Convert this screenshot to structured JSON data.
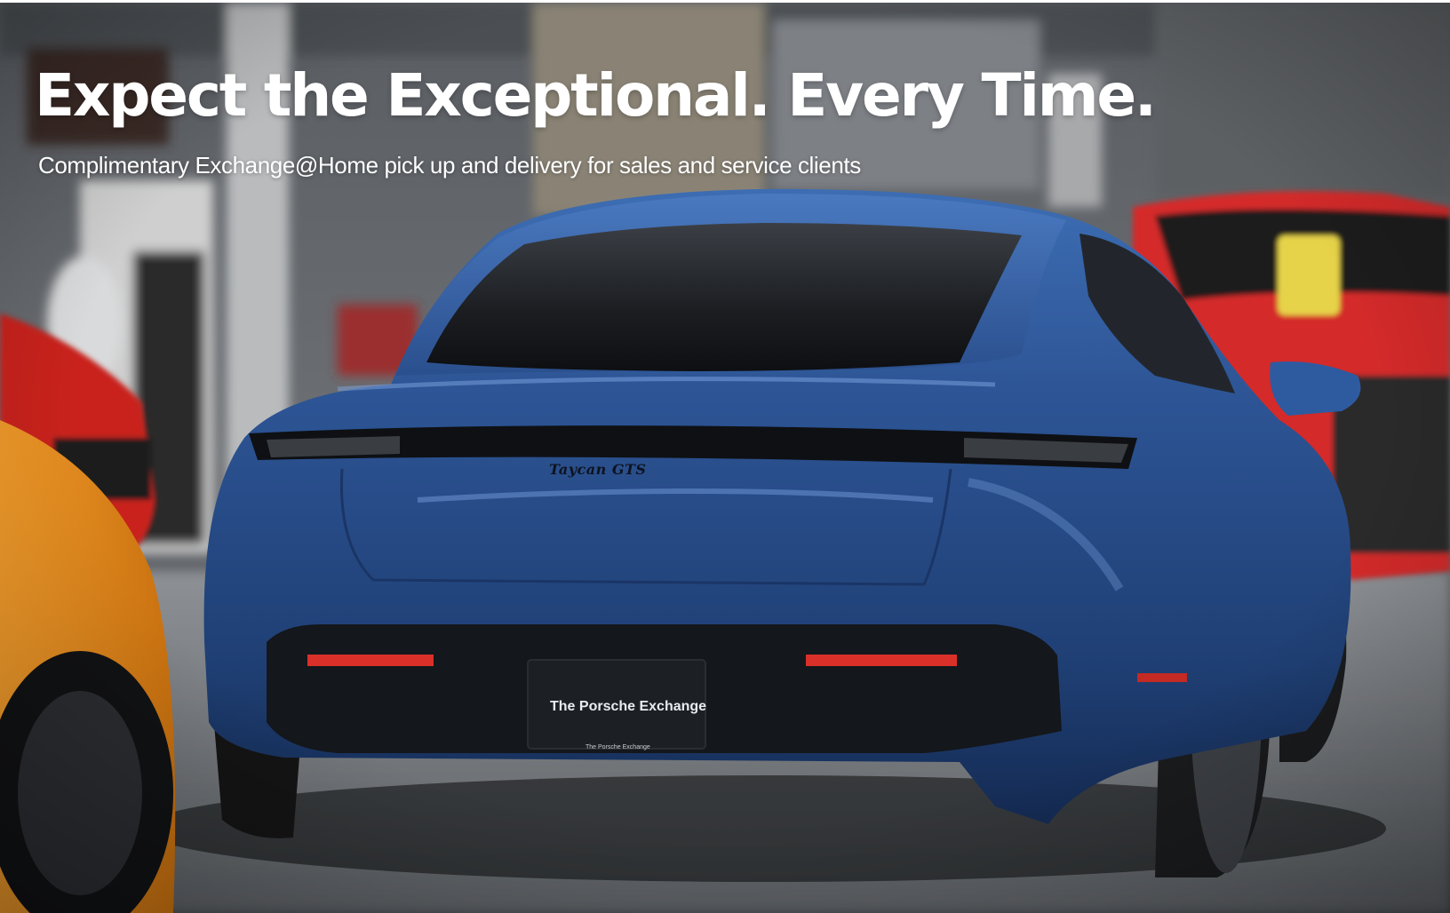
{
  "hero": {
    "headline": "Expect the Exceptional. Every Time.",
    "subheadline": "Complimentary Exchange@Home pick up and delivery for sales and service clients",
    "badge_text": "Taycan GTS",
    "plate_text": "The Porsche Exchange",
    "plate_small_text": "The Porsche Exchange"
  },
  "colors": {
    "car_body": "#2c5393",
    "background": "#3a3f46",
    "headline_text": "#ffffff",
    "orange_car": "#e98a1c",
    "red_car": "#d42a2a"
  }
}
